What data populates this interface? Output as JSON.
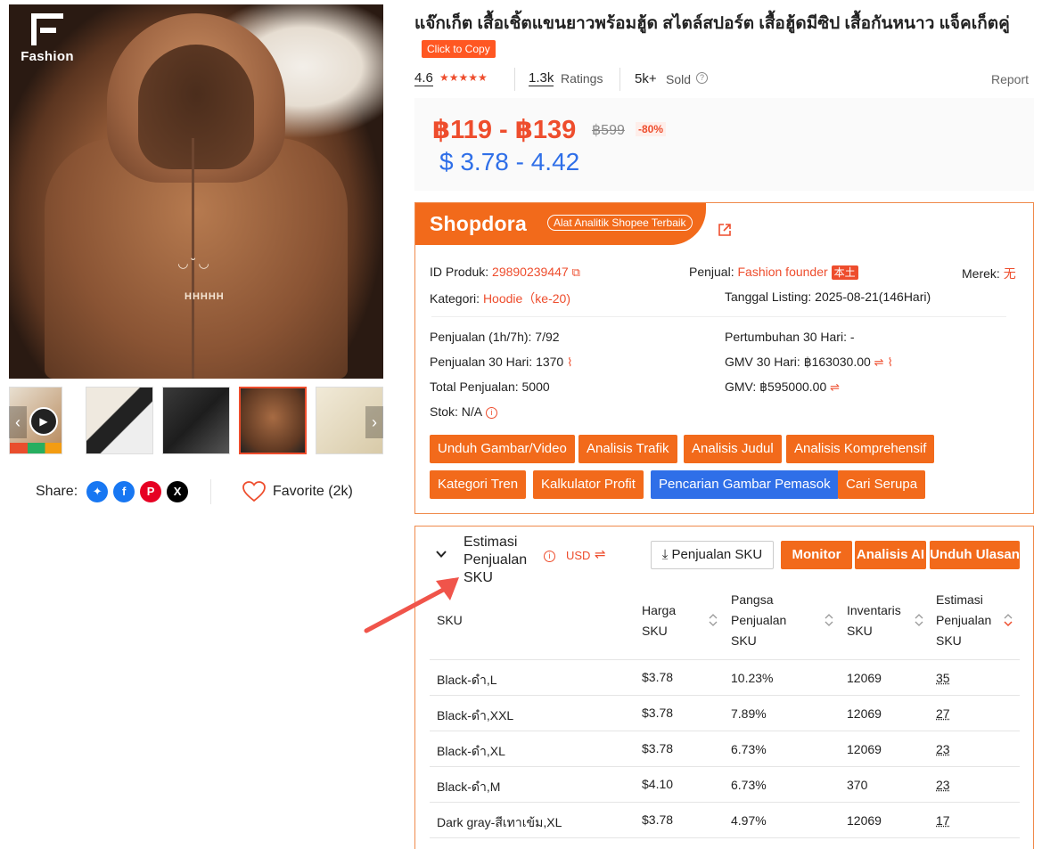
{
  "brand": {
    "logo_text": "Fashion"
  },
  "product": {
    "title": "แจ๊กเก็ต เสื้อเชิ้ตแขนยาวพร้อมฮู้ด สไตล์สปอร์ต เสื้อฮู้ดมีซิป เสื้อกันหนาว แจ็คเก็ตคู่",
    "copy_label": "Click to Copy",
    "rating": "4.6",
    "stars": "★★★★★",
    "ratings_count": "1.3k",
    "ratings_label": "Ratings",
    "sold_value": "5k+",
    "sold_label": "Sold",
    "report_label": "Report",
    "price_range": "฿119 - ฿139",
    "price_original": "฿599",
    "discount": "-80%",
    "price_usd": "$ 3.78 - 4.42"
  },
  "media": {
    "image_text": "HHHHH",
    "share_label": "Share:",
    "favorite_label": "Favorite (2k)"
  },
  "shopdora": {
    "logo": "Shopdora",
    "tagline": "Alat Analitik Shopee Terbaik",
    "product_id_label": "ID Produk:",
    "product_id": "29890239447",
    "seller_label": "Penjual:",
    "seller": "Fashion founder",
    "seller_tag": "本土",
    "brand_label": "Merek:",
    "brand_value": "无",
    "category_label": "Kategori:",
    "category": "Hoodie（ke-20)",
    "listing_date": "Tanggal Listing: 2025-08-21(146Hari)",
    "sales_1h7h": "Penjualan (1h/7h): 7/92",
    "growth_30": "Pertumbuhan 30 Hari: -",
    "sales_30": "Penjualan 30 Hari: 1370",
    "gmv_30": "GMV 30 Hari: ฿163030.00",
    "total_sales": "Total Penjualan: 5000",
    "gmv": "GMV: ฿595000.00",
    "stock": "Stok: N/A",
    "buttons": [
      "Unduh Gambar/Video",
      "Analisis Trafik",
      "Analisis Judul",
      "Analisis Komprehensif",
      "Kategori Tren",
      "Kalkulator Profit",
      "Pencarian Gambar Pemasok",
      "Cari Serupa"
    ]
  },
  "sku": {
    "title_lines": [
      "Estimasi",
      "Penjualan",
      "SKU"
    ],
    "currency": "USD",
    "btn_sku_sales": "Penjualan SKU",
    "btn_monitor": "Monitor",
    "btn_ai": "Analisis AI",
    "btn_reviews": "Unduh Ulasan",
    "headers": [
      [
        "SKU"
      ],
      [
        "Harga",
        "SKU"
      ],
      [
        "Pangsa",
        "Penjualan",
        "SKU"
      ],
      [
        "Inventaris",
        "SKU"
      ],
      [
        "Estimasi",
        "Penjualan",
        "SKU"
      ]
    ],
    "rows": [
      [
        "Black-ดำ,L",
        "$3.78",
        "10.23%",
        "12069",
        "35"
      ],
      [
        "Black-ดำ,XXL",
        "$3.78",
        "7.89%",
        "12069",
        "27"
      ],
      [
        "Black-ดำ,XL",
        "$3.78",
        "6.73%",
        "12069",
        "23"
      ],
      [
        "Black-ดำ,M",
        "$4.10",
        "6.73%",
        "370",
        "23"
      ],
      [
        "Dark gray-สีเทาเข้ม,XL",
        "$3.78",
        "4.97%",
        "12069",
        "17"
      ]
    ]
  },
  "colors": {
    "accent": "#f26a1b",
    "price": "#ee4d2d",
    "usd": "#2f6fe8",
    "blue_btn": "#2f6fe8"
  }
}
